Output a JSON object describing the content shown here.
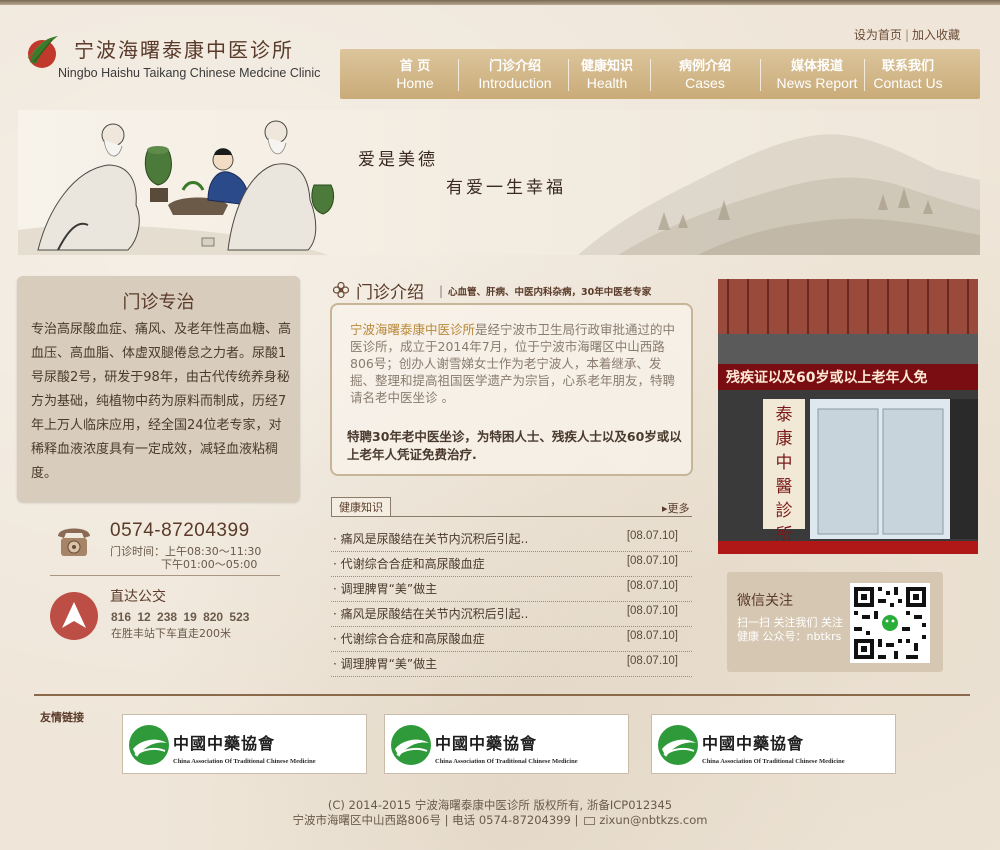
{
  "colors": {
    "background": "#efe6d9",
    "nav_bg": "#cfb284",
    "accent_text": "#5a3a28",
    "highlight": "#b8893a",
    "bus_icon": "#bc4e45",
    "photo_banner": "#7a0d12"
  },
  "header": {
    "logo_cn": "宁波海曙泰康中医诊所",
    "logo_en": "Ningbo Haishu Taikang  Chinese Medcine Clinic",
    "set_home": "设为首页",
    "add_favorite": "加入收藏",
    "toplink_sep": "|"
  },
  "nav": [
    {
      "cn": "首  页",
      "en": "Home"
    },
    {
      "cn": "门诊介绍",
      "en": "Introduction"
    },
    {
      "cn": "健康知识",
      "en": "Health"
    },
    {
      "cn": "病例介绍",
      "en": "Cases"
    },
    {
      "cn": "媒体报道",
      "en": "News Report"
    },
    {
      "cn": "联系我们",
      "en": "Contact Us"
    }
  ],
  "banner": {
    "slogan1": "爱是美德",
    "slogan2": "有爱一生幸福"
  },
  "specialty": {
    "title": "门诊专治",
    "text": "专治高尿酸血症、痛风、及老年性高血糖、高血压、高血脂、体虚双腿倦怠之力者。尿酸1号尿酸2号，研发于98年，由古代传统养身秘方为基础，纯植物中药为原料而制成，历经7年上万人临床应用，经全国24位老专家，对稀释血液浓度具有一定成效，减轻血液粘稠度。"
  },
  "contact": {
    "phone": "0574-87204399",
    "hours_line1": "门诊时间：上午08:30～11:30",
    "hours_line2": "下午01:00～05:00",
    "bus_title": "直达公交",
    "bus_lines": "816 12 238 19 820 523",
    "bus_note": "在胜丰站下车直走200米"
  },
  "intro": {
    "title": "门诊介绍",
    "sep": "|",
    "subtitle": "心血管、肝病、中医内科杂病，30年中医老专家",
    "name": "宁波海曙泰康中医诊所",
    "text_rest": "是经宁波市卫生局行政审批通过的中医诊所，成立于2014年7月，位于宁波市海曙区中山西路806号；创办人谢雪娣女士作为老宁波人，本着继承、发掘、整理和提高祖国医学遗产为宗旨，心系老年朋友，特聘请名老中医坐诊 。",
    "bold_text": "特聘30年老中医坐诊，为特困人士、残疾人士以及60岁或以上老年人凭证免费治疗."
  },
  "news": {
    "tab": "健康知识",
    "more": "更多",
    "items": [
      {
        "title": "· 痛风是尿酸结在关节内沉积后引起..",
        "date": "[08.07.10]"
      },
      {
        "title": "· 代谢综合合症和高尿酸血症",
        "date": "[08.07.10]"
      },
      {
        "title": "· 调理脾胃“美”做主",
        "date": "[08.07.10]"
      },
      {
        "title": "· 痛风是尿酸结在关节内沉积后引起..",
        "date": "[08.07.10]"
      },
      {
        "title": "· 代谢综合合症和高尿酸血症",
        "date": "[08.07.10]"
      },
      {
        "title": "· 调理脾胃“美”做主",
        "date": "[08.07.10]"
      }
    ]
  },
  "photo": {
    "banner_text": "残疾证以及60岁或以上老年人免",
    "sign_text": "泰康中醫診所"
  },
  "wechat": {
    "title": "微信关注",
    "text": "扫一扫 关注我们 关注健康 公众号：nbtkrs"
  },
  "links": {
    "label": "友情链接",
    "partners": [
      {
        "cn": "中國中藥協會",
        "en": "China Association Of Traditional Chinese Medicine"
      },
      {
        "cn": "中國中藥協會",
        "en": "China Association Of Traditional Chinese Medicine"
      },
      {
        "cn": "中國中藥協會",
        "en": "China Association Of Traditional Chinese Medicine"
      }
    ]
  },
  "footer": {
    "copyright": "(C) 2014-2015 宁波海曙泰康中医诊所 版权所有, 浙备ICP012345",
    "address": "宁波市海曙区中山西路806号 | 电话 0574-87204399 |",
    "email": "zixun@nbtkzs.com"
  }
}
